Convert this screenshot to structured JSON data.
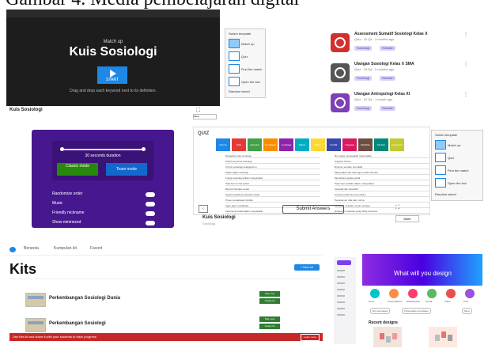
{
  "caption": "Gambar 4. Media pembelajaran digital",
  "matchup": {
    "subtitle": "Match up",
    "title": "Kuis Sosiologi",
    "start_label": "START",
    "hint": "Drag and drop each keyword next to its definition.",
    "bar_title": "Kuis Sosiologi",
    "more_label": "More"
  },
  "templates_menu": {
    "title": "Switch template",
    "items": [
      "Match up",
      "Quiz",
      "Find the match",
      "Open the box",
      "Random wheel"
    ]
  },
  "resources": [
    {
      "name": "Assessment Sumatif Sosiologi Kelas X",
      "meta": "Quiz · 10 Qs · 3 months ago",
      "tag1": "Sosiologi",
      "tag2": "Sekolah",
      "color": "#d32f2f"
    },
    {
      "name": "Ulangan Sosiologi Kelas X SMA",
      "meta": "Quiz · 15 Qs · 2 months ago",
      "tag1": "Sosiologi",
      "tag2": "Sekolah",
      "color": "#555555"
    },
    {
      "name": "Ulangan Antropologi Kelas XI",
      "meta": "Quiz · 12 Qs · 1 month ago",
      "tag1": "Sosiologi",
      "tag2": "Sekolah",
      "color": "#7e3fb8"
    }
  ],
  "kahoot": {
    "seconds_label": "30 seconds duration",
    "btn_classic": "Classic mode",
    "btn_team": "Team mode",
    "options": [
      "Randomize order",
      "Music",
      "Friendly nickname",
      "Show minimized"
    ],
    "bg": "#46178f"
  },
  "bingo": {
    "label": "QUIZ",
    "tiles": [
      "Norma",
      "Nilai",
      "Interaksi",
      "Sosialisasi",
      "Lembaga",
      "Status",
      "Peran",
      "Konflik",
      "Integrasi",
      "Mobilitas",
      "Struktur",
      "Kelompok"
    ],
    "tile_colors": [
      "#1e88e5",
      "#e53935",
      "#43a047",
      "#fb8c00",
      "#8e24aa",
      "#00acc1",
      "#fdd835",
      "#3949ab",
      "#d81b60",
      "#6d4c41",
      "#00897b",
      "#c0ca33"
    ],
    "left_lines": [
      "Pengertian dari sosiologi",
      "Tokoh pencetus sosiologi",
      "Ciri-ciri sosiologi sebagai ilmu",
      "Objek kajian sosiologi",
      "Fungsi sosiologi dalam masyarakat",
      "Nilai dan norma sosial",
      "Bentuk interaksi sosial",
      "Syarat terjadinya interaksi sosial",
      "Proses sosialisasi individu",
      "Agen-agen sosialisasi",
      "Kelompok sosial dalam masyarakat",
      "Lembaga sosial"
    ],
    "right_lines": [
      "Ilmu yang mempelajari masyarakat",
      "Auguste Comte",
      "Empiris, teoretis, kumulatif",
      "Masyarakat dan hubungan antarmanusia",
      "Memahami gejala sosial",
      "Pedoman perilaku dalam masyarakat",
      "Asosiatif dan disosiatif",
      "Kontak sosial dan komunikasi",
      "Penanaman nilai dan norma",
      "Keluarga, sekolah, teman sebaya",
      "Himpunan manusia yang hidup bersama",
      "Sistem norma untuk kebutuhan pokok"
    ],
    "submit_label": "Submit Answers",
    "bar_title": "Kuis Sosiologi",
    "bar_sub": "Sosiologi",
    "more_label": "More"
  },
  "kits": {
    "nav": [
      "Beranda",
      "Kumpulan kit",
      "Favorit"
    ],
    "heading": "Kits",
    "new_label": "+ New kit",
    "items": [
      {
        "name": "Perkembangan Sosiologi Dunia",
        "btn1": "Play now",
        "btn2": "Assign kit"
      },
      {
        "name": "Perkembangan Sosiologi",
        "btn1": "Play now",
        "btn2": "Assign kit"
      }
    ],
    "banner": "Use this kit and share it with your students to track progress",
    "banner_btn": "Learn more"
  },
  "canva": {
    "hero_text": "What will you design",
    "categories": [
      "Docs",
      "Presentations",
      "Whiteboards",
      "Social",
      "Video",
      "Print"
    ],
    "circle_colors": [
      "#00c4cc",
      "#ff8c42",
      "#ff3b6b",
      "#5cb85c",
      "#e94e4e",
      "#9b51e0"
    ],
    "pills": [
      "Doc templates",
      "Presentation templates",
      "More"
    ],
    "recent": "Recent designs"
  }
}
